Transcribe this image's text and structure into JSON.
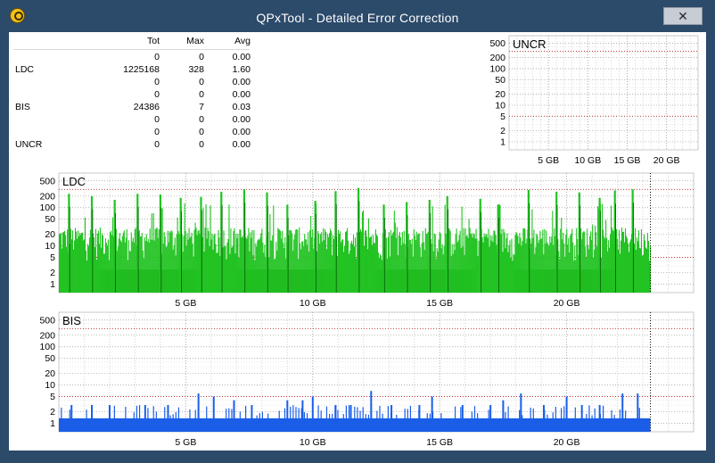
{
  "window": {
    "title": "QPxTool - Detailed Error Correction",
    "close_glyph": "✕"
  },
  "stats": {
    "headers": [
      "Tot",
      "Max",
      "Avg"
    ],
    "rows": [
      {
        "label": "",
        "tot": "0",
        "max": "0",
        "avg": "0.00"
      },
      {
        "label": "LDC",
        "tot": "1225168",
        "max": "328",
        "avg": "1.60"
      },
      {
        "label": "",
        "tot": "0",
        "max": "0",
        "avg": "0.00"
      },
      {
        "label": "",
        "tot": "0",
        "max": "0",
        "avg": "0.00"
      },
      {
        "label": "BIS",
        "tot": "24386",
        "max": "7",
        "avg": "0.03"
      },
      {
        "label": "",
        "tot": "0",
        "max": "0",
        "avg": "0.00"
      },
      {
        "label": "",
        "tot": "0",
        "max": "0",
        "avg": "0.00"
      },
      {
        "label": "UNCR",
        "tot": "0",
        "max": "0",
        "avg": "0.00"
      }
    ]
  },
  "colors": {
    "ldc_light": "#22c322",
    "ldc_dark": "#0a6e0a",
    "bis": "#1a5ee8",
    "threshold": "#c02020",
    "grid": "#9a9a9a"
  },
  "chart_data": [
    {
      "type": "bar",
      "title": "UNCR",
      "y_scale": "log",
      "y_ticks": [
        "500",
        "200",
        "100",
        "50",
        "20",
        "10",
        "5",
        "2",
        "1"
      ],
      "x_ticks": [
        "5 GB",
        "10 GB",
        "15 GB",
        "20 GB"
      ],
      "x_range_gb": [
        0,
        24
      ],
      "values": []
    },
    {
      "type": "bar",
      "title": "LDC",
      "y_scale": "log",
      "y_ticks": [
        "500",
        "200",
        "100",
        "50",
        "20",
        "10",
        "5",
        "2",
        "1"
      ],
      "x_ticks": [
        "5 GB",
        "10 GB",
        "15 GB",
        "20 GB"
      ],
      "x_range_gb": [
        0,
        25
      ],
      "data_end_gb": 23.3,
      "max_value": 328,
      "peaks": [
        {
          "x": 0.4,
          "y": 230
        },
        {
          "x": 1.3,
          "y": 200
        },
        {
          "x": 2.2,
          "y": 160
        },
        {
          "x": 3.1,
          "y": 230
        },
        {
          "x": 4.0,
          "y": 220
        },
        {
          "x": 4.8,
          "y": 180
        },
        {
          "x": 5.6,
          "y": 190
        },
        {
          "x": 6.4,
          "y": 260
        },
        {
          "x": 7.3,
          "y": 300
        },
        {
          "x": 8.2,
          "y": 250
        },
        {
          "x": 9.0,
          "y": 120
        },
        {
          "x": 10.1,
          "y": 150
        },
        {
          "x": 10.9,
          "y": 270
        },
        {
          "x": 11.8,
          "y": 328
        },
        {
          "x": 12.8,
          "y": 120
        },
        {
          "x": 13.7,
          "y": 140
        },
        {
          "x": 14.6,
          "y": 160
        },
        {
          "x": 15.3,
          "y": 200
        },
        {
          "x": 16.6,
          "y": 170
        },
        {
          "x": 17.3,
          "y": 120
        },
        {
          "x": 18.5,
          "y": 290
        },
        {
          "x": 19.6,
          "y": 260
        },
        {
          "x": 20.5,
          "y": 250
        },
        {
          "x": 21.3,
          "y": 180
        },
        {
          "x": 21.9,
          "y": 280
        },
        {
          "x": 22.6,
          "y": 300
        }
      ],
      "baseline_range": [
        4,
        30
      ]
    },
    {
      "type": "bar",
      "title": "BIS",
      "y_scale": "log",
      "y_ticks": [
        "500",
        "200",
        "100",
        "50",
        "20",
        "10",
        "5",
        "2",
        "1"
      ],
      "x_ticks": [
        "5 GB",
        "10 GB",
        "15 GB",
        "20 GB"
      ],
      "x_range_gb": [
        0,
        25
      ],
      "data_end_gb": 23.3,
      "max_value": 7,
      "peaks": [
        {
          "x": 0.5,
          "y": 3
        },
        {
          "x": 1.3,
          "y": 3
        },
        {
          "x": 2.0,
          "y": 3
        },
        {
          "x": 3.4,
          "y": 3
        },
        {
          "x": 4.3,
          "y": 3
        },
        {
          "x": 5.5,
          "y": 6
        },
        {
          "x": 6.1,
          "y": 5
        },
        {
          "x": 6.9,
          "y": 4
        },
        {
          "x": 7.6,
          "y": 3
        },
        {
          "x": 9.0,
          "y": 4
        },
        {
          "x": 9.6,
          "y": 4
        },
        {
          "x": 10.0,
          "y": 5
        },
        {
          "x": 10.9,
          "y": 3
        },
        {
          "x": 11.5,
          "y": 3
        },
        {
          "x": 12.3,
          "y": 7
        },
        {
          "x": 13.1,
          "y": 3
        },
        {
          "x": 14.2,
          "y": 3
        },
        {
          "x": 14.7,
          "y": 5
        },
        {
          "x": 15.9,
          "y": 3
        },
        {
          "x": 17.0,
          "y": 3
        },
        {
          "x": 17.5,
          "y": 4
        },
        {
          "x": 18.2,
          "y": 6
        },
        {
          "x": 19.1,
          "y": 3
        },
        {
          "x": 20.0,
          "y": 5
        },
        {
          "x": 20.6,
          "y": 3
        },
        {
          "x": 21.3,
          "y": 3
        },
        {
          "x": 22.2,
          "y": 6
        },
        {
          "x": 22.8,
          "y": 6
        }
      ],
      "baseline": 1
    }
  ]
}
